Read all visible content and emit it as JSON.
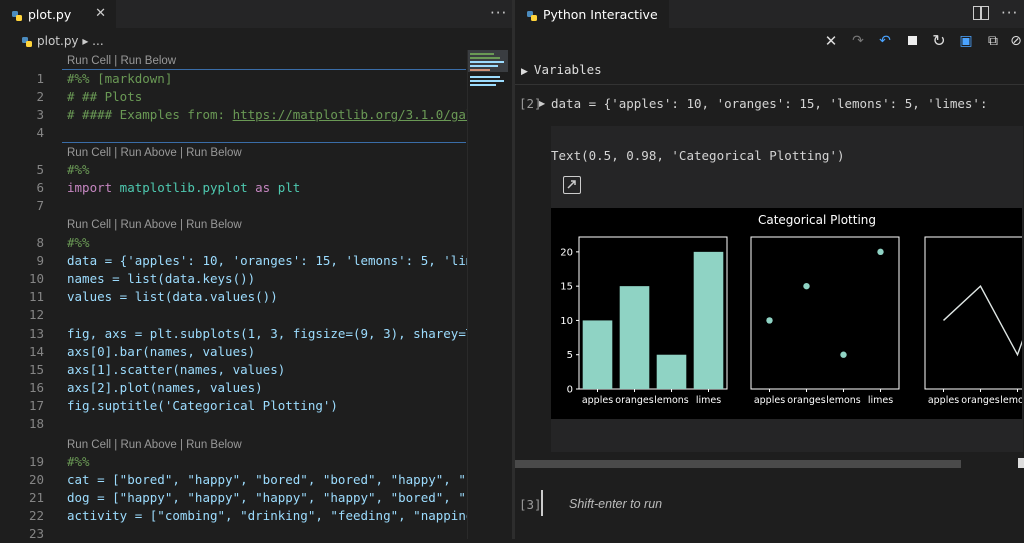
{
  "editor": {
    "tab_label": "plot.py",
    "tab_close": "✕",
    "more": "···",
    "breadcrumb": "plot.py ▸ ...",
    "lens": {
      "run_cell_below": "Run Cell | Run Below",
      "run_cell_above_below": "Run Cell | Run Above | Run Below"
    },
    "lines": {
      "1": "#%% [markdown]",
      "2": "# ## Plots",
      "3a": "# #### Examples from: ",
      "3b": "https://matplotlib.org/3.1.0/gal",
      "5": "#%%",
      "6a": "import",
      "6b": " matplotlib.pyplot ",
      "6c": "as",
      "6d": " plt",
      "8": "#%%",
      "9": "data = {'apples': 10, 'oranges': 15, 'lemons': 5, 'lim",
      "10": "names = list(data.keys())",
      "11": "values = list(data.values())",
      "13": "fig, axs = plt.subplots(1, 3, figsize=(9, 3), sharey=T",
      "14": "axs[0].bar(names, values)",
      "15": "axs[1].scatter(names, values)",
      "16": "axs[2].plot(names, values)",
      "17": "fig.suptitle('Categorical Plotting')",
      "19": "#%%",
      "20": "cat = [\"bored\", \"happy\", \"bored\", \"bored\", \"happy\", \"b",
      "21": "dog = [\"happy\", \"happy\", \"happy\", \"happy\", \"bored\", \"b",
      "22": "activity = [\"combing\", \"drinking\", \"feeding\", \"napping"
    },
    "line_numbers": [
      "1",
      "2",
      "3",
      "4",
      "5",
      "6",
      "7",
      "8",
      "9",
      "10",
      "11",
      "12",
      "13",
      "14",
      "15",
      "16",
      "17",
      "18",
      "19",
      "20",
      "21",
      "22",
      "23"
    ]
  },
  "interactive": {
    "tab_label": "Python Interactive",
    "variables_label": "Variables",
    "cell_prompt": "[2]",
    "cell_code": "data = {'apples': 10, 'oranges': 15, 'lemons': 5, 'limes':",
    "text_output": "Text(0.5, 0.98, 'Categorical Plotting')",
    "next_prompt": "[3]",
    "input_placeholder": "Shift-enter to run",
    "toolbar_icons": [
      "close-icon",
      "redo-icon",
      "undo-icon",
      "stop-icon",
      "restart-icon",
      "save-icon",
      "export-icon",
      "clear-all-icon"
    ]
  },
  "chart_data": {
    "type": "bar",
    "title": "Categorical Plotting",
    "categories": [
      "apples",
      "oranges",
      "lemons",
      "limes"
    ],
    "values": [
      10,
      15,
      5,
      20
    ],
    "ylim": [
      0,
      21
    ],
    "yticks": [
      0,
      5,
      10,
      15,
      20
    ],
    "subplots": [
      "bar",
      "scatter",
      "line"
    ],
    "color": "#8fd3c4"
  }
}
